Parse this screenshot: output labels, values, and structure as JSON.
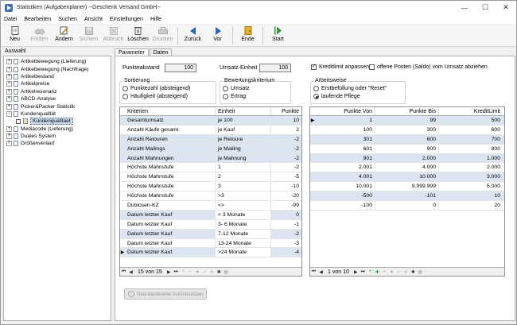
{
  "window": {
    "title": "Statistiken (Aufgabenplaner) --Geschenk Versand GmbH--"
  },
  "menu": [
    "Datei",
    "Bearbeiten",
    "Suchen",
    "Ansicht",
    "Einstellungen",
    "Hilfe"
  ],
  "toolbar": {
    "neu": "Neu",
    "finden": "Finden",
    "aendern": "Ändern",
    "sichern": "Sichern",
    "abbruch": "Abbruch",
    "loeschen": "Löschen",
    "drucken": "Drucken",
    "zurueck": "Zurück",
    "vor": "Vor",
    "ende": "Ende",
    "start": "Start"
  },
  "sidebar": {
    "label": "Auswahl",
    "items": [
      {
        "label": "Artikelbewegung (Lieferung)"
      },
      {
        "label": "Artikelbewegung (Nachfrage)"
      },
      {
        "label": "Artikelbestand"
      },
      {
        "label": "Artikelpreise"
      },
      {
        "label": "Artikelresonanz"
      },
      {
        "label": "ABCD-Analyse"
      },
      {
        "label": "Picker&Packer Statistik"
      },
      {
        "label": "Kundenqualität"
      },
      {
        "label": "Kundenqualitaet"
      },
      {
        "label": "Mediacode (Lieferung)"
      },
      {
        "label": "Duales System"
      },
      {
        "label": "Größenverlauf"
      }
    ]
  },
  "tabs": [
    "Parameter",
    "Daten"
  ],
  "params": {
    "punkteabstand_label": "Punkteabstand",
    "punkteabstand_value": "100",
    "umsatz_einheit_label": "Umsatz-Einheit",
    "umsatz_einheit_value": "100",
    "kreditlimit_label": "Kreditlimit anpassen",
    "offene_posten_label": "offene Posten (Saldo) vom Umsatz abziehen",
    "sortierung_title": "Sortierung",
    "sort_opt1": "Punktezahl (absteigend)",
    "sort_opt2": "Häufigkeit (absteigend)",
    "bewertung_title": "Bewertungskriterium",
    "bew_opt1": "Umsatz",
    "bew_opt2": "Ertrag",
    "arbeitsweise_title": "Arbeitsweise",
    "arb_opt1": "Erstbefüllung oder \"Reset\"",
    "arb_opt2": "laufende Pflege"
  },
  "left_grid": {
    "headers": [
      "Kriterien",
      "Einheit",
      "Punkte"
    ],
    "rows": [
      [
        "Gesamtumsatz",
        "je 100",
        "10"
      ],
      [
        "Anzahl Käufe gesamt",
        "je Kauf",
        "2"
      ],
      [
        "Anzahl Retouren",
        "je Retoure",
        "-2"
      ],
      [
        "Anzahl Mailings",
        "je Mailing",
        "-2"
      ],
      [
        "Anzahl Mahnungen",
        "je Mahnung",
        "-2"
      ],
      [
        "Höchste Mahnstufe",
        "1",
        "-2"
      ],
      [
        "Höchste Mahnstufe",
        "2",
        "-5"
      ],
      [
        "Höchste Mahnstufe",
        "3",
        "-10"
      ],
      [
        "Höchste Mahnstufe",
        ">3",
        "-20"
      ],
      [
        "Dubiosen-KZ",
        "<>",
        "-99"
      ],
      [
        "Datum letzter Kauf",
        "< 3 Monate",
        "0"
      ],
      [
        "Datum letzter Kauf",
        "3- 6 Monate",
        "-1"
      ],
      [
        "Datum letzter Kauf",
        "7-12 Monate",
        "-2"
      ],
      [
        "Datum letzter Kauf",
        "13-24 Monate",
        "-3"
      ],
      [
        "Datum letzter Kauf",
        ">24 Monate",
        "-4"
      ]
    ],
    "nav_text": "15 von 15"
  },
  "right_grid": {
    "headers": [
      "Punkte Von",
      "Punkte Bis",
      "KreditLimit"
    ],
    "rows": [
      [
        "1",
        "99",
        "500"
      ],
      [
        "100",
        "300",
        "600"
      ],
      [
        "301",
        "600",
        "700"
      ],
      [
        "601",
        "900",
        "800"
      ],
      [
        "901",
        "2.000",
        "1.000"
      ],
      [
        "2.001",
        "4.000",
        "2.000"
      ],
      [
        "4.001",
        "10.000",
        "3.000"
      ],
      [
        "10.001",
        "9.999.999",
        "5.000"
      ],
      [
        "-500",
        "-101",
        "10"
      ],
      [
        "-100",
        "0",
        "20"
      ]
    ],
    "nav_text": "1 von 10"
  },
  "reset_button": "Standardwerte zurücksetzen"
}
